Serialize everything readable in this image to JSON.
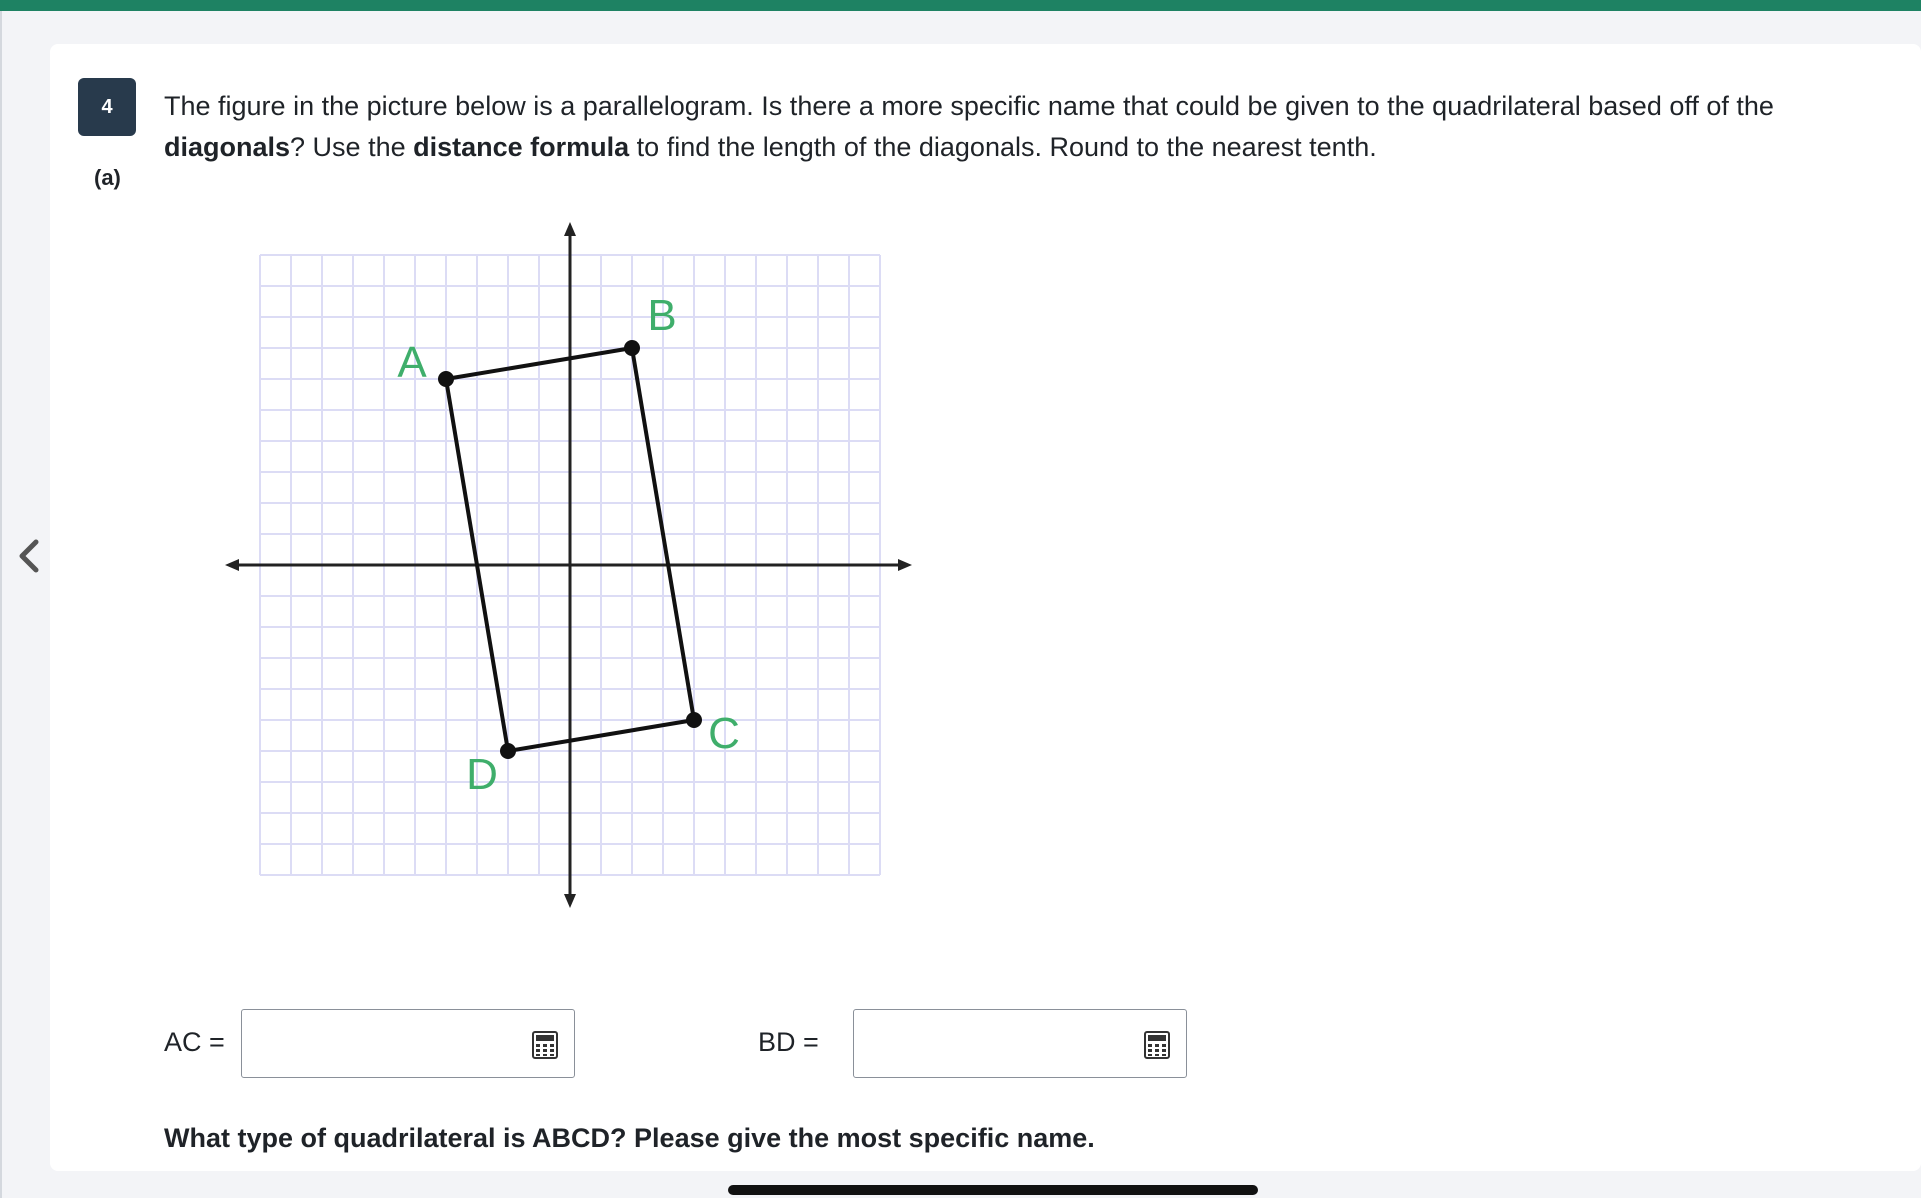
{
  "question": {
    "number": "4",
    "part_label": "(a)",
    "prompt_segments": [
      {
        "text": "The figure in the picture below is a parallelogram.  Is there a more specific name that could be given to the quadrilateral based off of the ",
        "bold": false
      },
      {
        "text": "diagonals",
        "bold": true
      },
      {
        "text": "? Use the ",
        "bold": false
      },
      {
        "text": "distance formula",
        "bold": true
      },
      {
        "text": " to find the length of the diagonals. Round to the nearest tenth.",
        "bold": false
      }
    ]
  },
  "figure": {
    "grid_range": {
      "x": [
        -10,
        10
      ],
      "y": [
        -10,
        10
      ]
    },
    "points": [
      {
        "label": "A",
        "x": -4,
        "y": 6
      },
      {
        "label": "B",
        "x": 2,
        "y": 7
      },
      {
        "label": "C",
        "x": 4,
        "y": -5
      },
      {
        "label": "D",
        "x": -2,
        "y": -6
      }
    ],
    "label_color": "#3fae6b",
    "grid_color": "#dcdcf5"
  },
  "answers": {
    "ac_label": "AC =",
    "ac_value": "",
    "bd_label": "BD =",
    "bd_value": ""
  },
  "followup_question": "What type of quadrilateral is ABCD? Please give the most specific name.",
  "icons": {
    "back": "chevron-left-icon",
    "calculator": "calculator-icon"
  },
  "colors": {
    "accent": "#1e8263",
    "badge": "#283a4c"
  }
}
